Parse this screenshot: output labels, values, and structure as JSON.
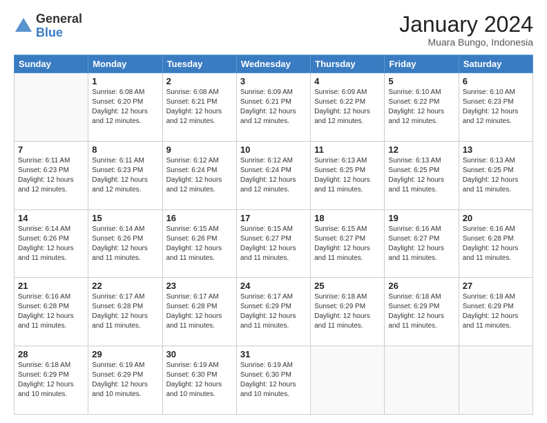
{
  "logo": {
    "general": "General",
    "blue": "Blue"
  },
  "title": "January 2024",
  "location": "Muara Bungo, Indonesia",
  "days_header": [
    "Sunday",
    "Monday",
    "Tuesday",
    "Wednesday",
    "Thursday",
    "Friday",
    "Saturday"
  ],
  "weeks": [
    [
      {
        "num": "",
        "info": ""
      },
      {
        "num": "1",
        "info": "Sunrise: 6:08 AM\nSunset: 6:20 PM\nDaylight: 12 hours\nand 12 minutes."
      },
      {
        "num": "2",
        "info": "Sunrise: 6:08 AM\nSunset: 6:21 PM\nDaylight: 12 hours\nand 12 minutes."
      },
      {
        "num": "3",
        "info": "Sunrise: 6:09 AM\nSunset: 6:21 PM\nDaylight: 12 hours\nand 12 minutes."
      },
      {
        "num": "4",
        "info": "Sunrise: 6:09 AM\nSunset: 6:22 PM\nDaylight: 12 hours\nand 12 minutes."
      },
      {
        "num": "5",
        "info": "Sunrise: 6:10 AM\nSunset: 6:22 PM\nDaylight: 12 hours\nand 12 minutes."
      },
      {
        "num": "6",
        "info": "Sunrise: 6:10 AM\nSunset: 6:23 PM\nDaylight: 12 hours\nand 12 minutes."
      }
    ],
    [
      {
        "num": "7",
        "info": "Sunrise: 6:11 AM\nSunset: 6:23 PM\nDaylight: 12 hours\nand 12 minutes."
      },
      {
        "num": "8",
        "info": "Sunrise: 6:11 AM\nSunset: 6:23 PM\nDaylight: 12 hours\nand 12 minutes."
      },
      {
        "num": "9",
        "info": "Sunrise: 6:12 AM\nSunset: 6:24 PM\nDaylight: 12 hours\nand 12 minutes."
      },
      {
        "num": "10",
        "info": "Sunrise: 6:12 AM\nSunset: 6:24 PM\nDaylight: 12 hours\nand 12 minutes."
      },
      {
        "num": "11",
        "info": "Sunrise: 6:13 AM\nSunset: 6:25 PM\nDaylight: 12 hours\nand 11 minutes."
      },
      {
        "num": "12",
        "info": "Sunrise: 6:13 AM\nSunset: 6:25 PM\nDaylight: 12 hours\nand 11 minutes."
      },
      {
        "num": "13",
        "info": "Sunrise: 6:13 AM\nSunset: 6:25 PM\nDaylight: 12 hours\nand 11 minutes."
      }
    ],
    [
      {
        "num": "14",
        "info": "Sunrise: 6:14 AM\nSunset: 6:26 PM\nDaylight: 12 hours\nand 11 minutes."
      },
      {
        "num": "15",
        "info": "Sunrise: 6:14 AM\nSunset: 6:26 PM\nDaylight: 12 hours\nand 11 minutes."
      },
      {
        "num": "16",
        "info": "Sunrise: 6:15 AM\nSunset: 6:26 PM\nDaylight: 12 hours\nand 11 minutes."
      },
      {
        "num": "17",
        "info": "Sunrise: 6:15 AM\nSunset: 6:27 PM\nDaylight: 12 hours\nand 11 minutes."
      },
      {
        "num": "18",
        "info": "Sunrise: 6:15 AM\nSunset: 6:27 PM\nDaylight: 12 hours\nand 11 minutes."
      },
      {
        "num": "19",
        "info": "Sunrise: 6:16 AM\nSunset: 6:27 PM\nDaylight: 12 hours\nand 11 minutes."
      },
      {
        "num": "20",
        "info": "Sunrise: 6:16 AM\nSunset: 6:28 PM\nDaylight: 12 hours\nand 11 minutes."
      }
    ],
    [
      {
        "num": "21",
        "info": "Sunrise: 6:16 AM\nSunset: 6:28 PM\nDaylight: 12 hours\nand 11 minutes."
      },
      {
        "num": "22",
        "info": "Sunrise: 6:17 AM\nSunset: 6:28 PM\nDaylight: 12 hours\nand 11 minutes."
      },
      {
        "num": "23",
        "info": "Sunrise: 6:17 AM\nSunset: 6:28 PM\nDaylight: 12 hours\nand 11 minutes."
      },
      {
        "num": "24",
        "info": "Sunrise: 6:17 AM\nSunset: 6:29 PM\nDaylight: 12 hours\nand 11 minutes."
      },
      {
        "num": "25",
        "info": "Sunrise: 6:18 AM\nSunset: 6:29 PM\nDaylight: 12 hours\nand 11 minutes."
      },
      {
        "num": "26",
        "info": "Sunrise: 6:18 AM\nSunset: 6:29 PM\nDaylight: 12 hours\nand 11 minutes."
      },
      {
        "num": "27",
        "info": "Sunrise: 6:18 AM\nSunset: 6:29 PM\nDaylight: 12 hours\nand 11 minutes."
      }
    ],
    [
      {
        "num": "28",
        "info": "Sunrise: 6:18 AM\nSunset: 6:29 PM\nDaylight: 12 hours\nand 10 minutes."
      },
      {
        "num": "29",
        "info": "Sunrise: 6:19 AM\nSunset: 6:29 PM\nDaylight: 12 hours\nand 10 minutes."
      },
      {
        "num": "30",
        "info": "Sunrise: 6:19 AM\nSunset: 6:30 PM\nDaylight: 12 hours\nand 10 minutes."
      },
      {
        "num": "31",
        "info": "Sunrise: 6:19 AM\nSunset: 6:30 PM\nDaylight: 12 hours\nand 10 minutes."
      },
      {
        "num": "",
        "info": ""
      },
      {
        "num": "",
        "info": ""
      },
      {
        "num": "",
        "info": ""
      }
    ]
  ]
}
